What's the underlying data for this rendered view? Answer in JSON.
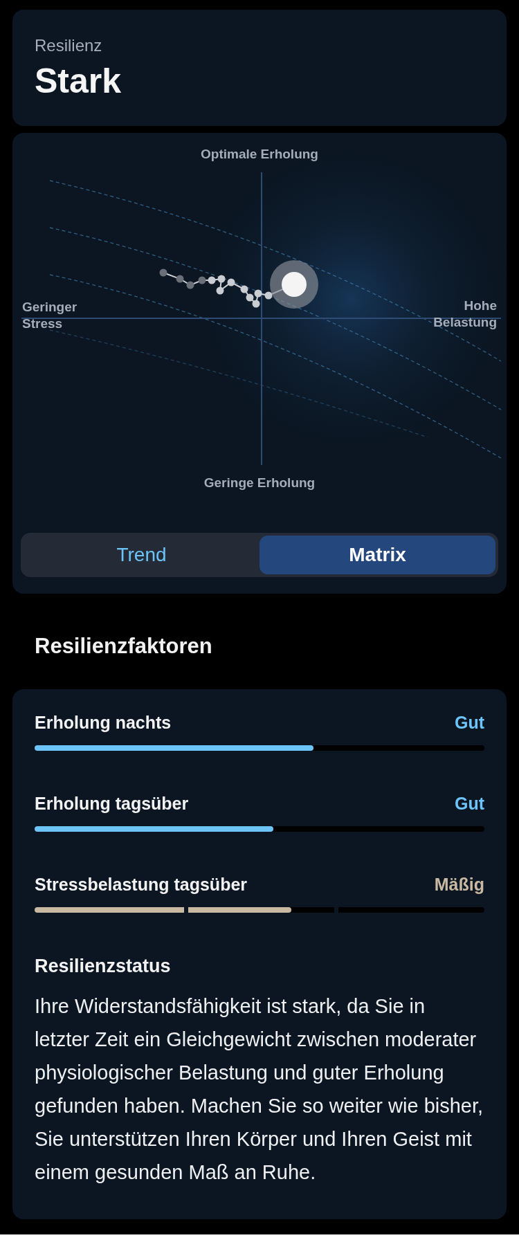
{
  "summary": {
    "label": "Resilienz",
    "value": "Stark"
  },
  "matrix": {
    "top_label": "Optimale Erholung",
    "bottom_label": "Geringe Erholung",
    "left_label": "Geringer Stress",
    "right_label": "Hohe Belastung"
  },
  "tabs": [
    {
      "label": "Trend",
      "selected": false
    },
    {
      "label": "Matrix",
      "selected": true
    }
  ],
  "factors_heading": "Resilienzfaktoren",
  "factors": [
    {
      "kind": "bar",
      "name": "Erholung nachts",
      "rating": "Gut",
      "color": "#6cc4f8",
      "level": 0.62
    },
    {
      "kind": "bar",
      "name": "Erholung tagsüber",
      "rating": "Gut",
      "color": "#6cc4f8",
      "level": 0.53
    },
    {
      "kind": "segmented",
      "name": "Stressbelastung tagsüber",
      "rating": "Mäßig",
      "color": "#c9b9a3",
      "level": 0.57
    }
  ],
  "status": {
    "title": "Resilienzstatus",
    "text": "Ihre Widerstandsfähigkeit ist stark, da Sie in letzter Zeit ein Gleichgewicht zwischen moderater physiologischer Belastung und guter Erholung gefunden haben. Machen Sie so weiter wie bisher, Sie unterstützen Ihren Körper und Ihren Geist mit einem gesunden Maß an Ruhe."
  }
}
